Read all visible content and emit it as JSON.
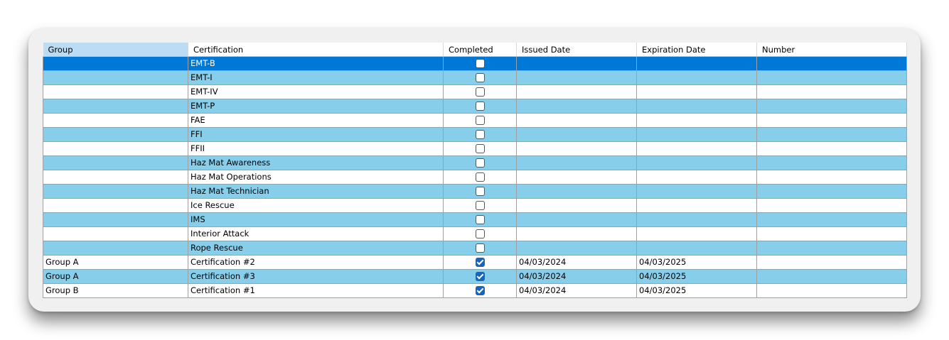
{
  "grid": {
    "columns": [
      "Group",
      "Certification",
      "Completed",
      "Issued Date",
      "Expiration Date",
      "Number"
    ],
    "rows": [
      {
        "group": "",
        "certification": "EMT-B",
        "completed": false,
        "issued": "",
        "expiration": "",
        "number": ""
      },
      {
        "group": "",
        "certification": "EMT-I",
        "completed": false,
        "issued": "",
        "expiration": "",
        "number": ""
      },
      {
        "group": "",
        "certification": "EMT-IV",
        "completed": false,
        "issued": "",
        "expiration": "",
        "number": ""
      },
      {
        "group": "",
        "certification": "EMT-P",
        "completed": false,
        "issued": "",
        "expiration": "",
        "number": ""
      },
      {
        "group": "",
        "certification": "FAE",
        "completed": false,
        "issued": "",
        "expiration": "",
        "number": ""
      },
      {
        "group": "",
        "certification": "FFI",
        "completed": false,
        "issued": "",
        "expiration": "",
        "number": ""
      },
      {
        "group": "",
        "certification": "FFII",
        "completed": false,
        "issued": "",
        "expiration": "",
        "number": ""
      },
      {
        "group": "",
        "certification": "Haz Mat Awareness",
        "completed": false,
        "issued": "",
        "expiration": "",
        "number": ""
      },
      {
        "group": "",
        "certification": "Haz Mat Operations",
        "completed": false,
        "issued": "",
        "expiration": "",
        "number": ""
      },
      {
        "group": "",
        "certification": "Haz Mat Technician",
        "completed": false,
        "issued": "",
        "expiration": "",
        "number": ""
      },
      {
        "group": "",
        "certification": "Ice Rescue",
        "completed": false,
        "issued": "",
        "expiration": "",
        "number": ""
      },
      {
        "group": "",
        "certification": "IMS",
        "completed": false,
        "issued": "",
        "expiration": "",
        "number": ""
      },
      {
        "group": "",
        "certification": "Interior Attack",
        "completed": false,
        "issued": "",
        "expiration": "",
        "number": ""
      },
      {
        "group": "",
        "certification": "Rope Rescue",
        "completed": false,
        "issued": "",
        "expiration": "",
        "number": ""
      },
      {
        "group": "Group A",
        "certification": "Certification #2",
        "completed": true,
        "issued": "04/03/2024",
        "expiration": "04/03/2025",
        "number": ""
      },
      {
        "group": "Group A",
        "certification": "Certification #3",
        "completed": true,
        "issued": "04/03/2024",
        "expiration": "04/03/2025",
        "number": ""
      },
      {
        "group": "Group B",
        "certification": "Certification #1",
        "completed": true,
        "issued": "04/03/2024",
        "expiration": "04/03/2025",
        "number": ""
      }
    ],
    "selected_row": 0,
    "sorted_column": 0
  },
  "colors": {
    "row_alt": "#87ceeb",
    "row_plain": "#ffffff",
    "selection": "#0078d7",
    "sorted_header": "#bcdcf4",
    "check_fill": "#1565c0"
  }
}
